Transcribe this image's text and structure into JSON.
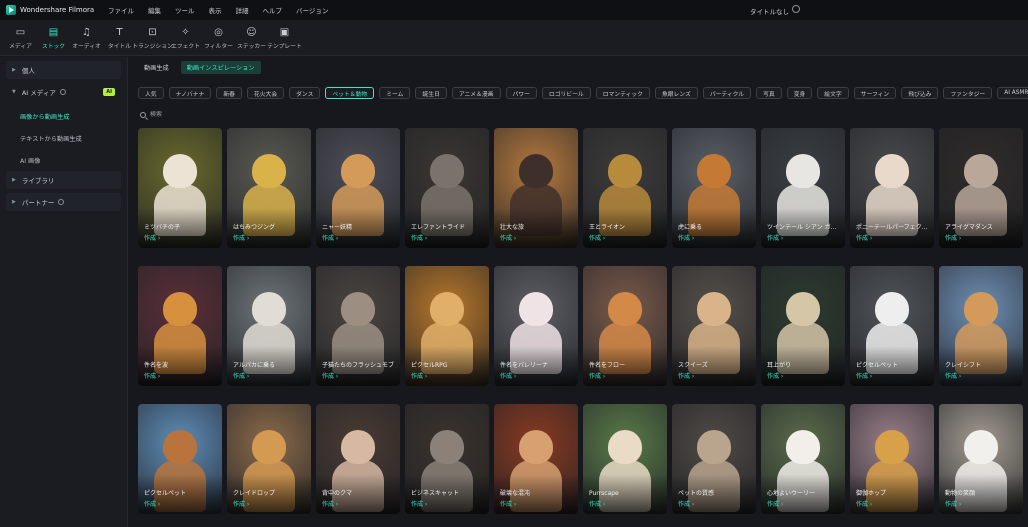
{
  "app": {
    "name": "Wondershare Filmora",
    "document_title": "タイトルなし"
  },
  "menu": [
    "ファイル",
    "編集",
    "ツール",
    "表示",
    "詳細",
    "ヘルプ",
    "バージョン"
  ],
  "toolbar": [
    {
      "label": "メディア",
      "icon": "media-icon",
      "active": false
    },
    {
      "label": "ストック",
      "icon": "stock-icon",
      "active": true
    },
    {
      "label": "オーディオ",
      "icon": "music-note-icon",
      "active": false
    },
    {
      "label": "タイトル",
      "icon": "title-t-icon",
      "active": false
    },
    {
      "label": "トランジション",
      "icon": "transition-icon",
      "active": false
    },
    {
      "label": "エフェクト",
      "icon": "effect-icon",
      "active": false
    },
    {
      "label": "フィルター",
      "icon": "filter-icon",
      "active": false
    },
    {
      "label": "ステッカー",
      "icon": "sticker-icon",
      "active": false
    },
    {
      "label": "テンプレート",
      "icon": "template-icon",
      "active": false
    }
  ],
  "sidebar": {
    "items": [
      {
        "label": "個人"
      },
      {
        "label": "AI メディア",
        "badge": "AI"
      },
      {
        "label": "ライブラリ"
      },
      {
        "label": "パートナー"
      }
    ],
    "sub_items": [
      {
        "label": "画像から動画生成",
        "active": true
      },
      {
        "label": "テキストから動画生成",
        "active": false
      },
      {
        "label": "AI 画像",
        "active": false
      }
    ]
  },
  "tabs": [
    {
      "label": "動画生成",
      "active": false
    },
    {
      "label": "動画インスピレーション",
      "active": true
    }
  ],
  "chips": [
    "人気",
    "ナノバナナ",
    "新春",
    "花火大会",
    "ダンス",
    "ペット＆動物",
    "ミーム",
    "誕生日",
    "アニメ＆漫画",
    "パワー",
    "ロゴリビール",
    "ロマンティック",
    "魚眼レンズ",
    "パーティクル",
    "写真",
    "変身",
    "絵文字",
    "サーフィン",
    "飛び込み",
    "ファンタジー",
    "AI ASMR",
    "紙"
  ],
  "active_chip": "ペット＆動物",
  "search": {
    "placeholder": "検索"
  },
  "card_action": "作成 ›",
  "cards": [
    {
      "title": "ミツバチの子",
      "bg": "#6a6a2c",
      "fg": "#ece3d4"
    },
    {
      "title": "はちみつジング",
      "bg": "#5b5a52",
      "fg": "#d9b24a"
    },
    {
      "title": "ニャー妖精",
      "bg": "#4e4f57",
      "fg": "#d49a5a"
    },
    {
      "title": "エレファントライド",
      "bg": "#3a3632",
      "fg": "#7a736b"
    },
    {
      "title": "壮大な旅",
      "bg": "#b5793e",
      "fg": "#3f2f2a"
    },
    {
      "title": "王とライオン",
      "bg": "#3d3b3a",
      "fg": "#b88a3c"
    },
    {
      "title": "虎に乗る",
      "bg": "#5a5f66",
      "fg": "#c47a35"
    },
    {
      "title": "ツインテール シアン ガ…",
      "bg": "#3b3f44",
      "fg": "#e8e6e2"
    },
    {
      "title": "ポニーテールパーフェク…",
      "bg": "#4a4a4c",
      "fg": "#e9d9cb"
    },
    {
      "title": "アライグマダンス",
      "bg": "#2f2b29",
      "fg": "#b9a79a"
    },
    {
      "title": "件名を波",
      "bg": "#5b2f38",
      "fg": "#d7913e"
    },
    {
      "title": "アルパカに乗る",
      "bg": "#6e7478",
      "fg": "#e2ddd4"
    },
    {
      "title": "子猫たちのフラッシュモブ",
      "bg": "#4a4540",
      "fg": "#9c8f82"
    },
    {
      "title": "ピクセルRPG",
      "bg": "#b7772b",
      "fg": "#e0b06a"
    },
    {
      "title": "件名をバレリーナ",
      "bg": "#5d5d63",
      "fg": "#efe3e6"
    },
    {
      "title": "件名をフロー",
      "bg": "#7a5a4a",
      "fg": "#d38a48"
    },
    {
      "title": "スクイーズ",
      "bg": "#56504a",
      "fg": "#d9b48a"
    },
    {
      "title": "耳上がり",
      "bg": "#2d3b2f",
      "fg": "#d5c6a8"
    },
    {
      "title": "ピクセルペット",
      "bg": "#505458",
      "fg": "#eeeeee"
    },
    {
      "title": "クレイシフト",
      "bg": "#6f8fb4",
      "fg": "#d39a5c"
    },
    {
      "title": "ピクセルペット",
      "bg": "#5f8db8",
      "fg": "#b8743c"
    },
    {
      "title": "クレイドロップ",
      "bg": "#8a6a4a",
      "fg": "#d59a52"
    },
    {
      "title": "背中のクマ",
      "bg": "#4a3b33",
      "fg": "#d7b8a2"
    },
    {
      "title": "ビジネスキャット",
      "bg": "#3b332d",
      "fg": "#8b8178"
    },
    {
      "title": "破壊な混沌",
      "bg": "#8a3a22",
      "fg": "#d6a070"
    },
    {
      "title": "Purrscape",
      "bg": "#5a7a4a",
      "fg": "#e9dbc6"
    },
    {
      "title": "ペットの質感",
      "bg": "#4f4a45",
      "fg": "#b9a58e"
    },
    {
      "title": "心地よいウーリー",
      "bg": "#5b6c4c",
      "fg": "#f2eeea"
    },
    {
      "title": "御伽ホップ",
      "bg": "#9a7f88",
      "fg": "#d9a04a"
    },
    {
      "title": "動物の笑顔",
      "bg": "#a49c91",
      "fg": "#f2f0ec"
    }
  ]
}
